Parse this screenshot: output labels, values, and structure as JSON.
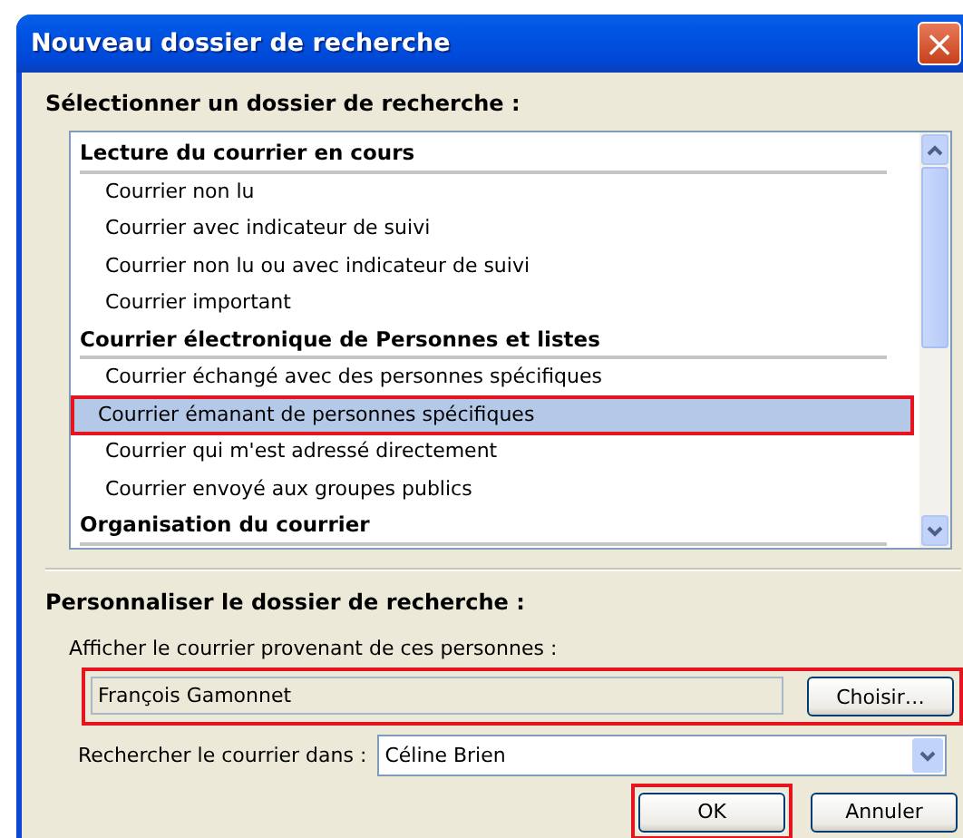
{
  "window": {
    "title": "Nouveau dossier de recherche",
    "close_symbol": "×"
  },
  "select_label": "Sélectionner un dossier de recherche :",
  "folder_list": [
    {
      "kind": "header",
      "label": "Lecture du courrier en cours"
    },
    {
      "kind": "item",
      "label": "Courrier non lu",
      "selected": false,
      "highlighted": false
    },
    {
      "kind": "item",
      "label": "Courrier avec indicateur de suivi",
      "selected": false,
      "highlighted": false
    },
    {
      "kind": "item",
      "label": "Courrier non lu ou avec indicateur de suivi",
      "selected": false,
      "highlighted": false
    },
    {
      "kind": "item",
      "label": "Courrier important",
      "selected": false,
      "highlighted": false
    },
    {
      "kind": "header",
      "label": "Courrier électronique de Personnes et listes"
    },
    {
      "kind": "item",
      "label": "Courrier échangé avec des personnes spécifiques",
      "selected": false,
      "highlighted": false
    },
    {
      "kind": "item",
      "label": "Courrier émanant de personnes spécifiques",
      "selected": true,
      "highlighted": true
    },
    {
      "kind": "item",
      "label": "Courrier qui m'est adressé directement",
      "selected": false,
      "highlighted": false
    },
    {
      "kind": "item",
      "label": "Courrier envoyé aux groupes publics",
      "selected": false,
      "highlighted": false
    },
    {
      "kind": "header",
      "label": "Organisation du courrier"
    }
  ],
  "customize": {
    "title": "Personnaliser le dossier de recherche :",
    "people_label": "Afficher le courrier provenant de ces personnes :",
    "people_value": "François Gamonnet",
    "people_highlighted": true,
    "choose_button": "Choisir…",
    "search_in_label": "Rechercher le courrier dans :",
    "search_in_value": "Céline Brien"
  },
  "buttons": [
    {
      "label": "OK",
      "highlighted": true
    },
    {
      "label": "Annuler",
      "highlighted": false
    }
  ]
}
